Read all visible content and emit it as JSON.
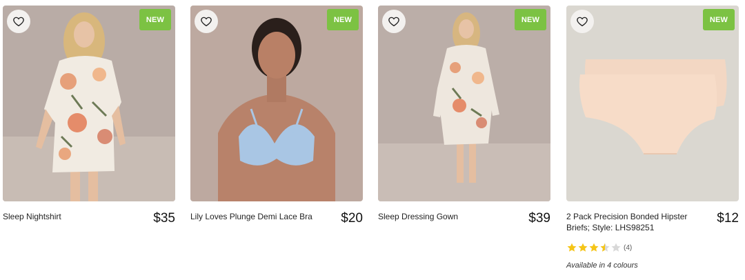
{
  "products": [
    {
      "name": "Sleep Nightshirt",
      "price": "$35",
      "badge": "NEW",
      "image": "woman-in-floral-nightshirt"
    },
    {
      "name": "Lily Loves Plunge Demi Lace Bra",
      "price": "$20",
      "badge": "NEW",
      "image": "woman-in-blue-lace-bra"
    },
    {
      "name": "Sleep Dressing Gown",
      "price": "$39",
      "badge": "NEW",
      "image": "woman-in-floral-dressing-gown"
    },
    {
      "name": "2 Pack Precision Bonded Hipster Briefs; Style: LHS98251",
      "price": "$12",
      "badge": "NEW",
      "image": "nude-hipster-briefs",
      "rating": {
        "value": 3.5,
        "max": 5,
        "count": "(4)"
      },
      "colours": "Available in 4 colours"
    }
  ],
  "icons": {
    "wishlist": "heart-outline-icon",
    "star": "star-icon"
  },
  "colors": {
    "badge": "#7cc243",
    "star": "#f5c518",
    "star_empty": "#d8d8d8"
  }
}
